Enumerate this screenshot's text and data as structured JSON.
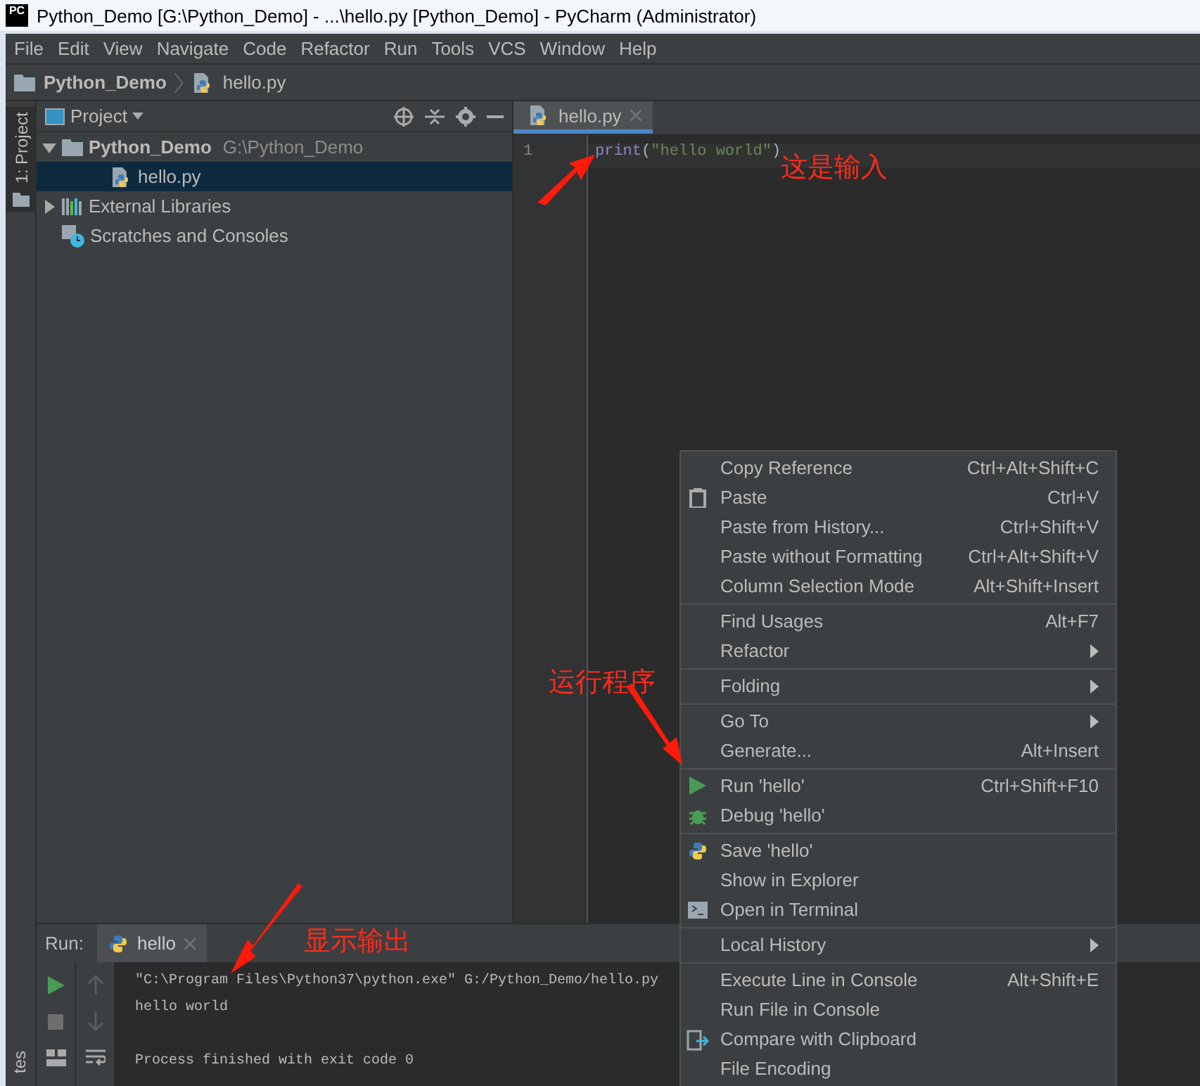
{
  "window": {
    "logo": "PC",
    "title": "Python_Demo [G:\\Python_Demo] - ...\\hello.py [Python_Demo] - PyCharm (Administrator)"
  },
  "menu_bar": [
    "File",
    "Edit",
    "View",
    "Navigate",
    "Code",
    "Refactor",
    "Run",
    "Tools",
    "VCS",
    "Window",
    "Help"
  ],
  "breadcrumb": [
    {
      "label": "Python_Demo",
      "kind": "folder"
    },
    {
      "label": "hello.py",
      "kind": "python"
    }
  ],
  "tool_stripe": {
    "top": {
      "label": "1: Project",
      "selected": true
    },
    "bottom": {
      "label": "tes"
    }
  },
  "project_panel": {
    "title": "Project",
    "tree": [
      {
        "label": "Python_Demo",
        "path": "G:\\Python_Demo",
        "kind": "folder",
        "expanded": true,
        "selected": false,
        "children": [
          {
            "label": "hello.py",
            "kind": "python",
            "selected": true
          }
        ]
      },
      {
        "label": "External Libraries",
        "kind": "libraries",
        "expanded": false,
        "selected": false
      },
      {
        "label": "Scratches and Consoles",
        "kind": "scratches",
        "selected": false
      }
    ]
  },
  "editor": {
    "tabs": [
      {
        "label": "hello.py",
        "selected": true
      }
    ],
    "lines": [
      {
        "number": "1",
        "tokens": [
          {
            "text": "print",
            "kind": "builtin"
          },
          {
            "text": "(",
            "kind": "paren"
          },
          {
            "text": "\"hello world\"",
            "kind": "string"
          },
          {
            "text": ")",
            "kind": "paren"
          }
        ]
      }
    ]
  },
  "run_panel": {
    "label": "Run:",
    "tabs": [
      {
        "label": "hello",
        "selected": true
      }
    ],
    "output": [
      {
        "text": "\"C:\\Program Files\\Python37\\python.exe\" G:/Python_Demo/hello.py",
        "kind": "command"
      },
      {
        "text": "hello world",
        "kind": "output"
      },
      {
        "text": "Process finished with exit code 0",
        "kind": "status"
      }
    ]
  },
  "context_menu": {
    "groups": [
      [
        {
          "label": "Copy Reference",
          "shortcut": "Ctrl+Alt+Shift+C"
        },
        {
          "label": "Paste",
          "shortcut": "Ctrl+V",
          "kind": "paste"
        },
        {
          "label": "Paste from History...",
          "shortcut": "Ctrl+Shift+V"
        },
        {
          "label": "Paste without Formatting",
          "shortcut": "Ctrl+Alt+Shift+V"
        },
        {
          "label": "Column Selection Mode",
          "shortcut": "Alt+Shift+Insert"
        }
      ],
      [
        {
          "label": "Find Usages",
          "shortcut": "Alt+F7"
        },
        {
          "label": "Refactor",
          "submenu": true
        }
      ],
      [
        {
          "label": "Folding",
          "submenu": true
        }
      ],
      [
        {
          "label": "Go To",
          "submenu": true
        },
        {
          "label": "Generate...",
          "shortcut": "Alt+Insert"
        }
      ],
      [
        {
          "label": "Run 'hello'",
          "shortcut": "Ctrl+Shift+F10",
          "kind": "run"
        },
        {
          "label": "Debug 'hello'",
          "kind": "debug"
        }
      ],
      [
        {
          "label": "Save 'hello'",
          "kind": "python"
        },
        {
          "label": "Show in Explorer"
        },
        {
          "label": "Open in Terminal",
          "kind": "terminal"
        }
      ],
      [
        {
          "label": "Local History",
          "submenu": true
        }
      ],
      [
        {
          "label": "Execute Line in Console",
          "shortcut": "Alt+Shift+E"
        },
        {
          "label": "Run File in Console"
        },
        {
          "label": "Compare with Clipboard",
          "kind": "compare"
        },
        {
          "label": "File Encoding"
        }
      ]
    ]
  },
  "annotations": [
    {
      "text": "这是输入"
    },
    {
      "text": "运行程序"
    },
    {
      "text": "显示输出"
    }
  ]
}
